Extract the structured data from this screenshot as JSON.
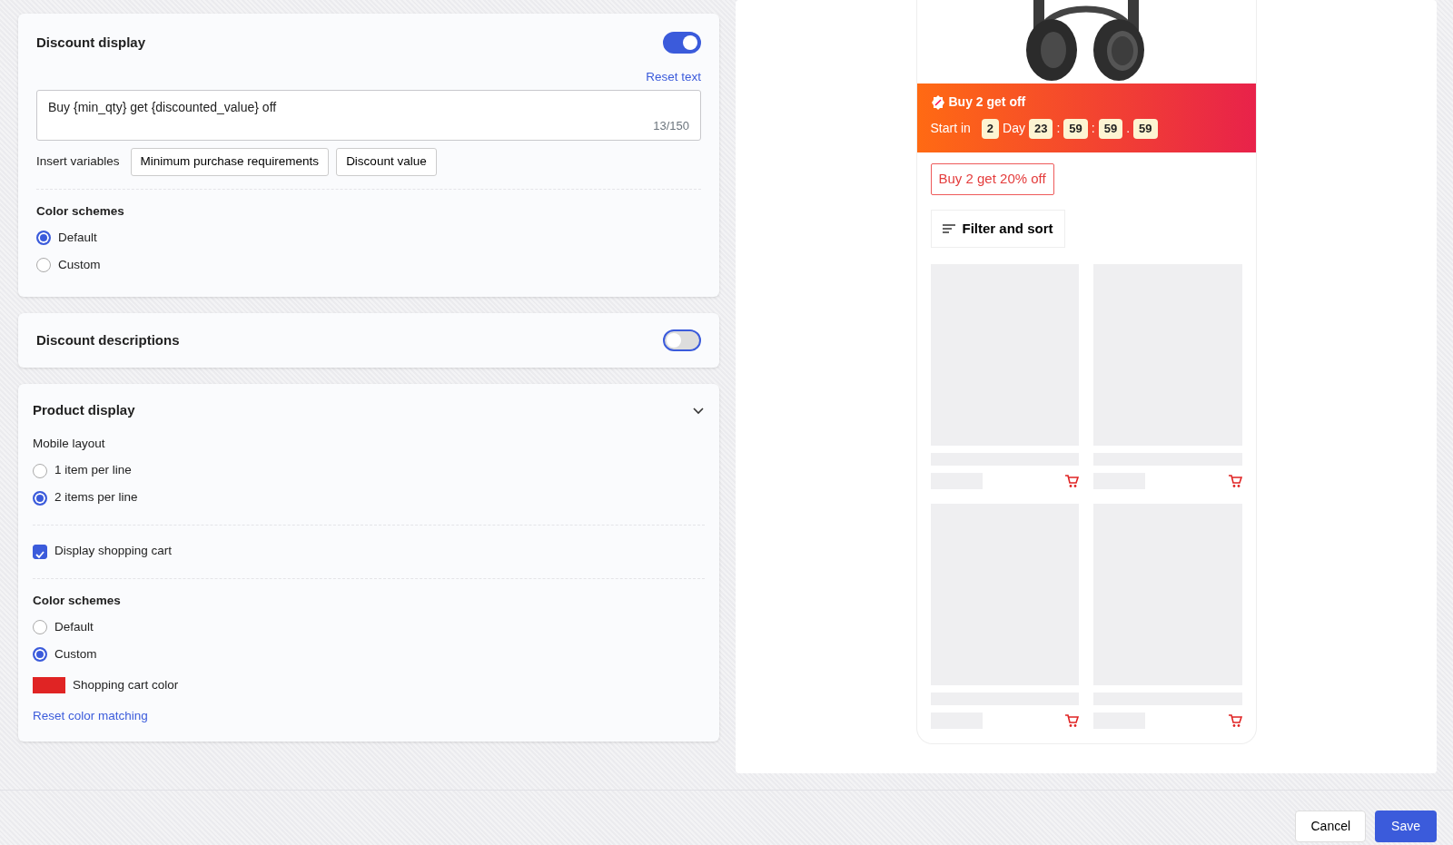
{
  "discount_display": {
    "title": "Discount display",
    "enabled": true,
    "reset_link": "Reset text",
    "text_value": "Buy {min_qty} get {discounted_value} off",
    "counter": "13/150",
    "insert_label": "Insert variables",
    "variable_buttons": [
      "Minimum purchase requirements",
      "Discount value"
    ],
    "color_label": "Color schemes",
    "color_options": [
      {
        "label": "Default",
        "selected": true
      },
      {
        "label": "Custom",
        "selected": false
      }
    ]
  },
  "discount_descriptions": {
    "title": "Discount descriptions",
    "enabled": false
  },
  "product_display": {
    "title": "Product display",
    "expanded": true,
    "layout_label": "Mobile layout",
    "layout_options": [
      {
        "label": "1 item per line",
        "selected": false
      },
      {
        "label": "2 items per line",
        "selected": true
      }
    ],
    "show_cart": {
      "label": "Display shopping cart",
      "checked": true
    },
    "color_label": "Color schemes",
    "color_options": [
      {
        "label": "Default",
        "selected": false
      },
      {
        "label": "Custom",
        "selected": true
      }
    ],
    "cart_color": {
      "label": "Shopping cart color",
      "color": "#e02424"
    },
    "reset_link": "Reset color matching"
  },
  "preview": {
    "banner_title": "Buy 2 get off",
    "countdown_label": "Start in",
    "countdown": [
      {
        "kind": "box",
        "text": "2"
      },
      {
        "kind": "text",
        "text": "Day"
      },
      {
        "kind": "box",
        "text": "23"
      },
      {
        "kind": "sep",
        "text": ":"
      },
      {
        "kind": "box",
        "text": "59"
      },
      {
        "kind": "sep",
        "text": ":"
      },
      {
        "kind": "box",
        "text": "59"
      },
      {
        "kind": "sep",
        "text": "."
      },
      {
        "kind": "box",
        "text": "59"
      }
    ],
    "tag": "Buy 2 get 20% off",
    "filter_button": "Filter and sort",
    "products": [
      {
        "kind": "skeleton"
      },
      {
        "kind": "skeleton"
      },
      {
        "kind": "skeleton"
      },
      {
        "kind": "skeleton"
      }
    ]
  },
  "footer": {
    "cancel": "Cancel",
    "save": "Save"
  }
}
